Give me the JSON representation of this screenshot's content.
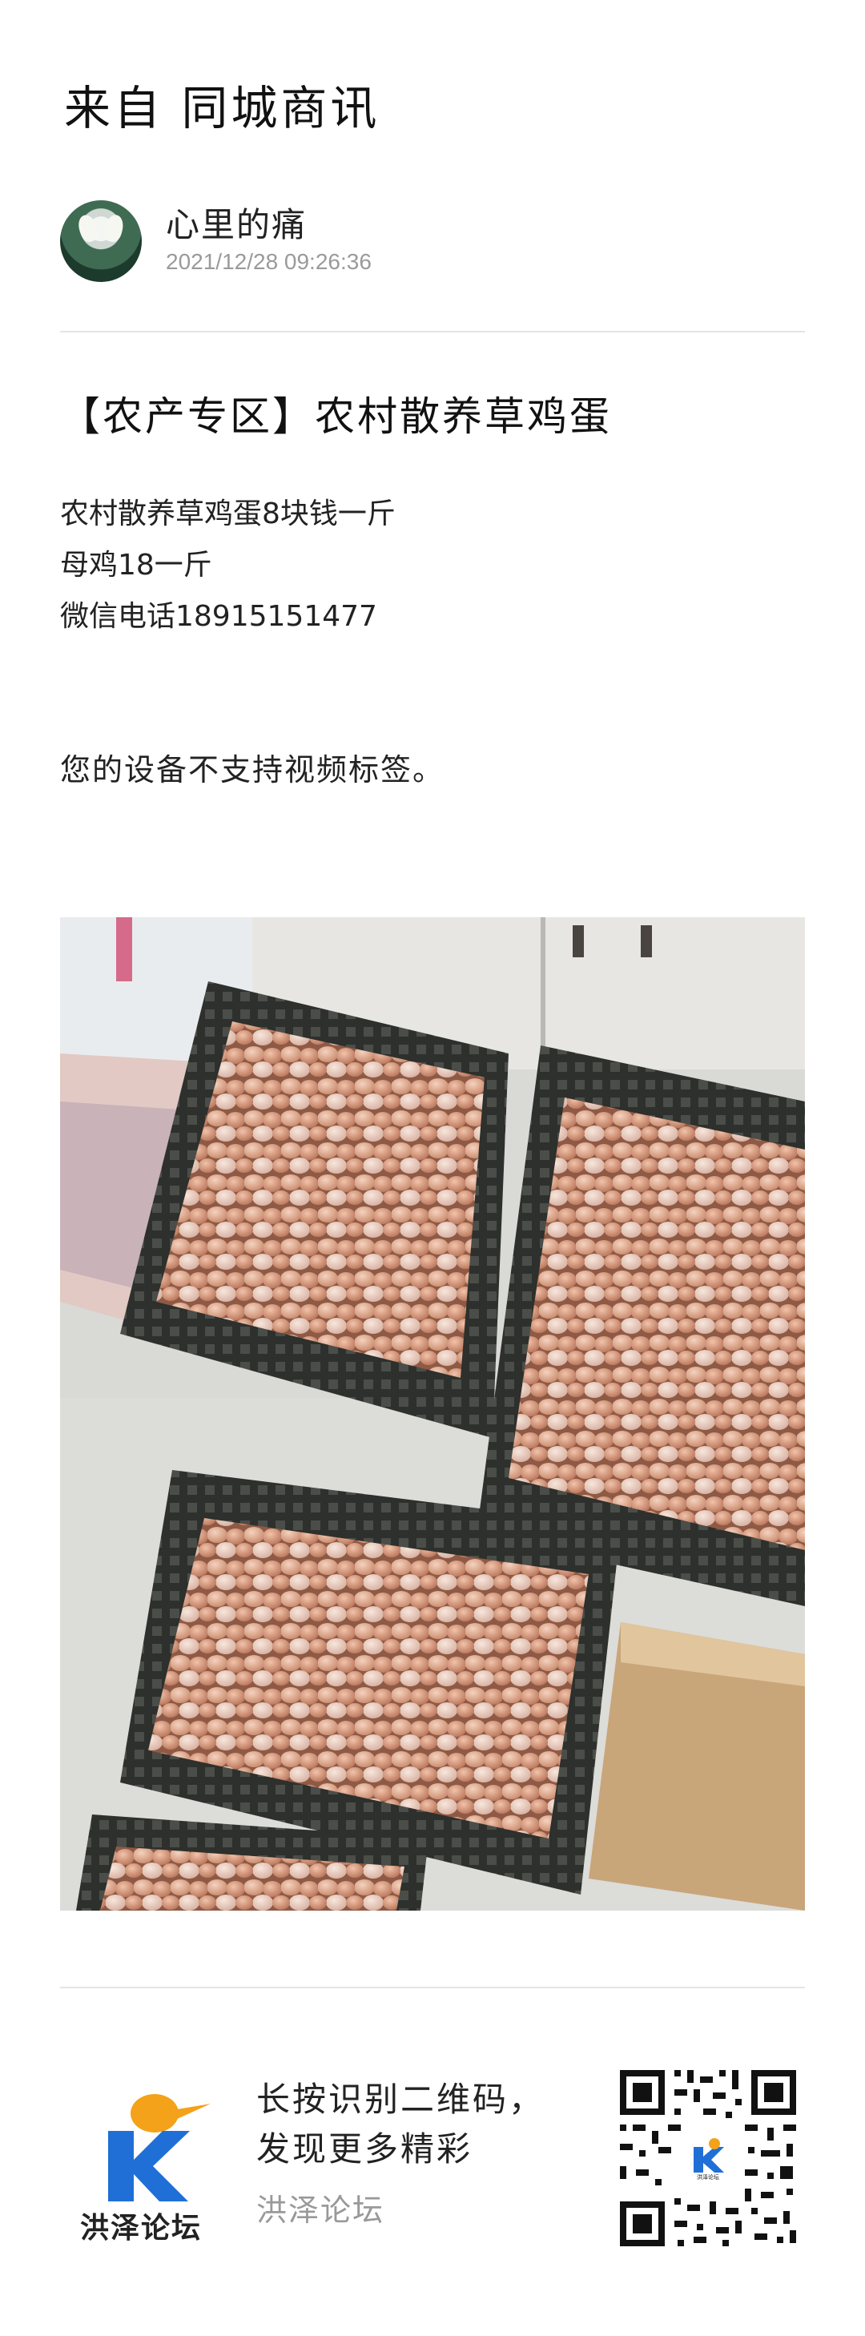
{
  "header": {
    "source": "来自 同城商讯"
  },
  "author": {
    "name": "心里的痛",
    "timestamp": "2021/12/28 09:26:36"
  },
  "post": {
    "title": "【农产专区】农村散养草鸡蛋",
    "lines": [
      "农村散养草鸡蛋8块钱一斤",
      "母鸡18一斤",
      "微信电话18915151477"
    ],
    "video_notice": "您的设备不支持视频标签。"
  },
  "footer": {
    "logo_text": "洪泽论坛",
    "line1": "长按识别二维码，",
    "line2": "发现更多精彩",
    "forum_name": "洪泽论坛",
    "qr_logo_text": "洪泽论坛"
  },
  "colors": {
    "logo_blue": "#1f6fd6",
    "logo_orange": "#f4a21a",
    "divider": "#e4e4e4"
  }
}
